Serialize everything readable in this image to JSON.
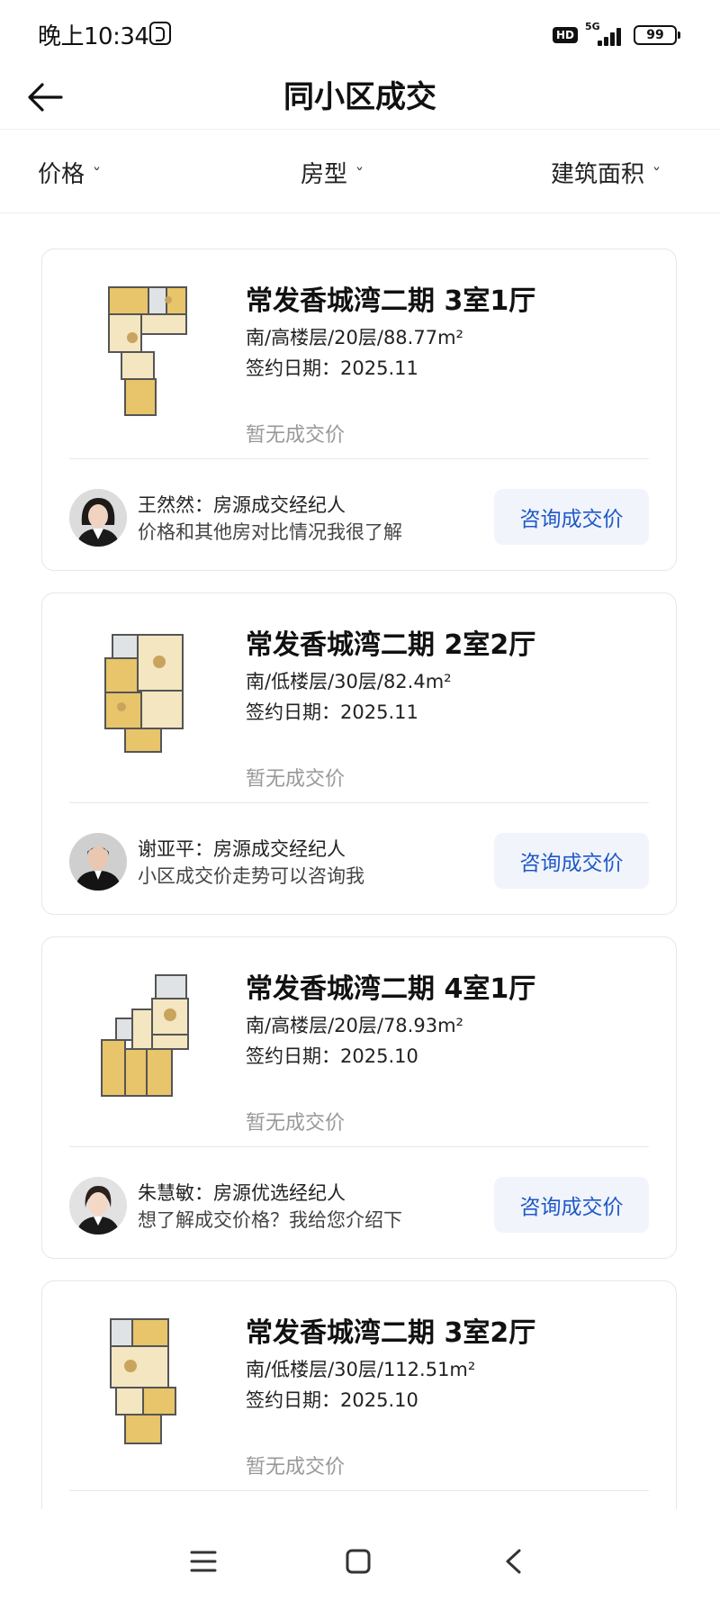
{
  "status_bar": {
    "time": "晚上10:34",
    "network": "5G",
    "hd": "HD",
    "battery": "99"
  },
  "header": {
    "title": "同小区成交",
    "back_icon": "arrow-left-icon"
  },
  "filters": [
    {
      "label": "价格"
    },
    {
      "label": "房型"
    },
    {
      "label": "建筑面积"
    }
  ],
  "listings": [
    {
      "title": "常发香城湾二期 3室1厅",
      "spec": "南/高楼层/20层/88.77m²",
      "date": "签约日期：2025.11",
      "price": "暂无成交价",
      "agent": "王然然：房源成交经纪人",
      "message": "价格和其他房对比情况我很了解",
      "button": "咨询成交价"
    },
    {
      "title": "常发香城湾二期 2室2厅",
      "spec": "南/低楼层/30层/82.4m²",
      "date": "签约日期：2025.11",
      "price": "暂无成交价",
      "agent": "谢亚平：房源成交经纪人",
      "message": "小区成交价走势可以咨询我",
      "button": "咨询成交价"
    },
    {
      "title": "常发香城湾二期 4室1厅",
      "spec": "南/高楼层/20层/78.93m²",
      "date": "签约日期：2025.10",
      "price": "暂无成交价",
      "agent": "朱慧敏：房源优选经纪人",
      "message": "想了解成交价格？我给您介绍下",
      "button": "咨询成交价"
    },
    {
      "title": "常发香城湾二期 3室2厅",
      "spec": "南/低楼层/30层/112.51m²",
      "date": "签约日期：2025.10",
      "price": "暂无成交价",
      "agent": "",
      "message": "",
      "button": ""
    }
  ],
  "nav_bar": {
    "icons": [
      "menu-icon",
      "home-icon",
      "back-icon"
    ]
  },
  "colors": {
    "accent": "#1f59c9",
    "button_bg": "#f1f4fb",
    "muted_text": "#999999",
    "border": "#e6e6e6",
    "floorplan_wood": "#e8c46a",
    "floorplan_tile": "#f3e6c0"
  }
}
